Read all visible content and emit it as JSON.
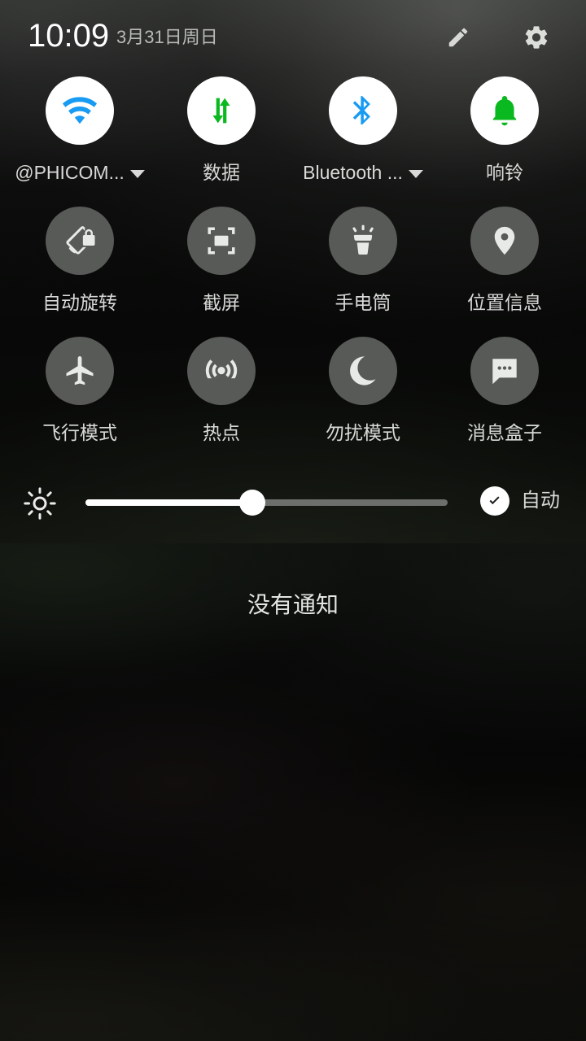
{
  "statusbar": {
    "time": "10:09",
    "date": "3月31日周日",
    "edit_icon": "pencil-icon",
    "settings_icon": "gear-icon"
  },
  "quick_settings": {
    "tiles": [
      {
        "id": "wifi",
        "label": "@PHICOM...",
        "icon": "wifi-icon",
        "state": "on",
        "color": "#189bf2",
        "caret": true
      },
      {
        "id": "mobile-data",
        "label": "数据",
        "icon": "data-arrows-icon",
        "state": "on",
        "color": "#0ab81f",
        "caret": false
      },
      {
        "id": "bluetooth",
        "label": "Bluetooth ...",
        "icon": "bluetooth-icon",
        "state": "on",
        "color": "#189bf2",
        "caret": true
      },
      {
        "id": "ringer",
        "label": "响铃",
        "icon": "bell-icon",
        "state": "on",
        "color": "#0ab81f",
        "caret": false
      },
      {
        "id": "auto-rotate",
        "label": "自动旋转",
        "icon": "rotation-lock-icon",
        "state": "off",
        "color": "#e8eae7",
        "caret": false
      },
      {
        "id": "screenshot",
        "label": "截屏",
        "icon": "screenshot-icon",
        "state": "off",
        "color": "#e8eae7",
        "caret": false
      },
      {
        "id": "flashlight",
        "label": "手电筒",
        "icon": "flashlight-icon",
        "state": "off",
        "color": "#e8eae7",
        "caret": false
      },
      {
        "id": "location",
        "label": "位置信息",
        "icon": "location-pin-icon",
        "state": "off",
        "color": "#e8eae7",
        "caret": false
      },
      {
        "id": "airplane",
        "label": "飞行模式",
        "icon": "airplane-icon",
        "state": "off",
        "color": "#e8eae7",
        "caret": false
      },
      {
        "id": "hotspot",
        "label": "热点",
        "icon": "hotspot-icon",
        "state": "off",
        "color": "#e8eae7",
        "caret": false
      },
      {
        "id": "dnd",
        "label": "勿扰模式",
        "icon": "moon-icon",
        "state": "off",
        "color": "#e8eae7",
        "caret": false
      },
      {
        "id": "message-box",
        "label": "消息盒子",
        "icon": "chat-bubble-icon",
        "state": "off",
        "color": "#e8eae7",
        "caret": false
      }
    ]
  },
  "brightness": {
    "icon": "brightness-sun-icon",
    "value_percent": 46,
    "auto_label": "自动",
    "auto_checked": true,
    "check_icon": "check-icon"
  },
  "notifications": {
    "empty_text": "没有通知"
  },
  "theme": {
    "accent_blue": "#189bf2",
    "accent_green": "#0ab81f",
    "tile_on_bg": "#ffffff",
    "tile_off_bg": "#585a57",
    "text_primary": "#ffffff",
    "text_secondary": "#d8dad7"
  }
}
